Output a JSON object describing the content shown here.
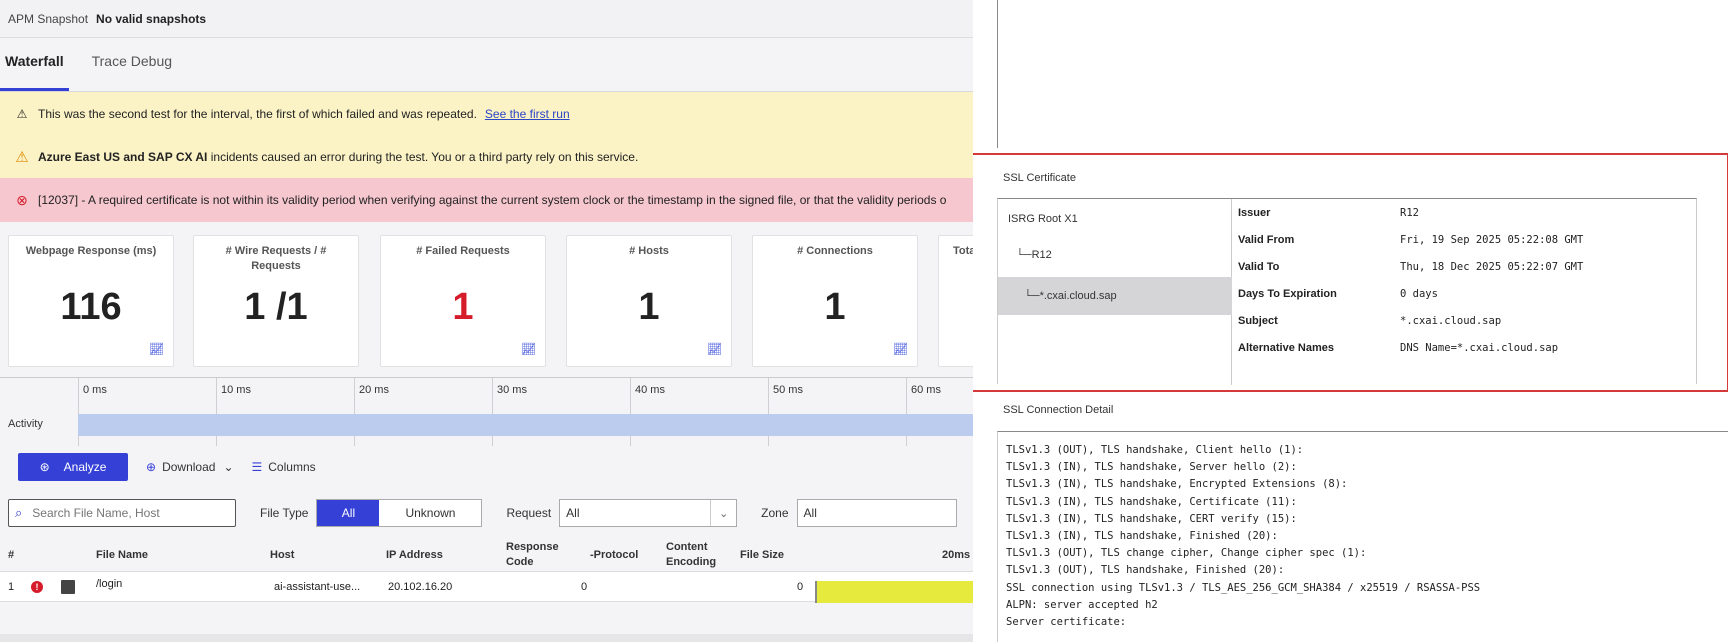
{
  "snapshot": {
    "label": "APM Snapshot",
    "value": "No valid snapshots"
  },
  "tabs": [
    {
      "label": "Waterfall"
    },
    {
      "label": "Trace Debug"
    }
  ],
  "banners": {
    "retry": {
      "text": "This was the second test for the interval, the first of which failed and was repeated.",
      "link": "See the first run"
    },
    "incident": {
      "bold": "Azure East US and SAP CX AI",
      "text": " incidents caused an error during the test. You or a third party rely on this service."
    },
    "error": {
      "text": "[12037] - A required certificate is not within its validity period when verifying against the current system clock or the timestamp in the signed file, or that the validity periods o"
    }
  },
  "cards": [
    {
      "title": "Webpage Response (ms)",
      "value": "116"
    },
    {
      "title": "# Wire Requests / # Requests",
      "value": "1 /1"
    },
    {
      "title": "# Failed Requests",
      "value": "1"
    },
    {
      "title": "# Hosts",
      "value": "1"
    },
    {
      "title": "# Connections",
      "value": "1"
    },
    {
      "title": "Tota",
      "value": ""
    }
  ],
  "timeline": {
    "ticks": [
      "0 ms",
      "10 ms",
      "20 ms",
      "30 ms",
      "40 ms",
      "50 ms",
      "60 ms"
    ],
    "activity_label": "Activity"
  },
  "toolbar": {
    "analyze": "Analyze",
    "download": "Download",
    "columns": "Columns"
  },
  "filters": {
    "search_placeholder": "Search File Name, Host",
    "file_type_label": "File Type",
    "file_type_options": [
      "All",
      "Unknown"
    ],
    "request_label": "Request",
    "request_value": "All",
    "zone_label": "Zone",
    "zone_value": "All"
  },
  "table": {
    "headers": {
      "num": "#",
      "file": "File Name",
      "host": "Host",
      "ip": "IP Address",
      "response": "Response Code",
      "protocol": "-Protocol",
      "encoding": "Content Encoding",
      "size": "File Size",
      "timescale": "20ms"
    },
    "rows": [
      {
        "num": "1",
        "file": "/login",
        "host": "ai-assistant-use...",
        "ip": "20.102.16.20",
        "response": "0",
        "size": "0"
      }
    ]
  },
  "ssl_certificate": {
    "title": "SSL Certificate",
    "chain": [
      "ISRG Root X1",
      "R12",
      "*.cxai.cloud.sap"
    ],
    "chain_prefix": [
      "",
      "└─",
      "└─"
    ],
    "properties": [
      {
        "key": "Issuer",
        "value": "R12"
      },
      {
        "key": "Valid From",
        "value": "Fri, 19 Sep 2025 05:22:08 GMT"
      },
      {
        "key": "Valid To",
        "value": "Thu, 18 Dec 2025 05:22:07 GMT"
      },
      {
        "key": "Days To Expiration",
        "value": "0 days"
      },
      {
        "key": "Subject",
        "value": "*.cxai.cloud.sap"
      },
      {
        "key": "Alternative Names",
        "value": "DNS Name=*.cxai.cloud.sap"
      }
    ]
  },
  "ssl_connection": {
    "title": "SSL Connection Detail",
    "lines": [
      "TLSv1.3 (OUT), TLS handshake, Client hello (1):",
      "TLSv1.3 (IN), TLS handshake, Server hello (2):",
      "TLSv1.3 (IN), TLS handshake, Encrypted Extensions (8):",
      "TLSv1.3 (IN), TLS handshake, Certificate (11):",
      "TLSv1.3 (IN), TLS handshake, CERT verify (15):",
      "TLSv1.3 (IN), TLS handshake, Finished (20):",
      "TLSv1.3 (OUT), TLS change cipher, Change cipher spec (1):",
      "TLSv1.3 (OUT), TLS handshake, Finished (20):",
      "SSL connection using TLSv1.3 / TLS_AES_256_GCM_SHA384 / x25519 / RSASSA-PSS",
      "ALPN: server accepted h2",
      "Server certificate:"
    ]
  },
  "colors": {
    "accent": "#3540d6",
    "error": "#d61c2b",
    "warn_bg": "#fbf3c6",
    "error_bg": "#f6c7cf",
    "highlight_border": "#d43a3a"
  }
}
